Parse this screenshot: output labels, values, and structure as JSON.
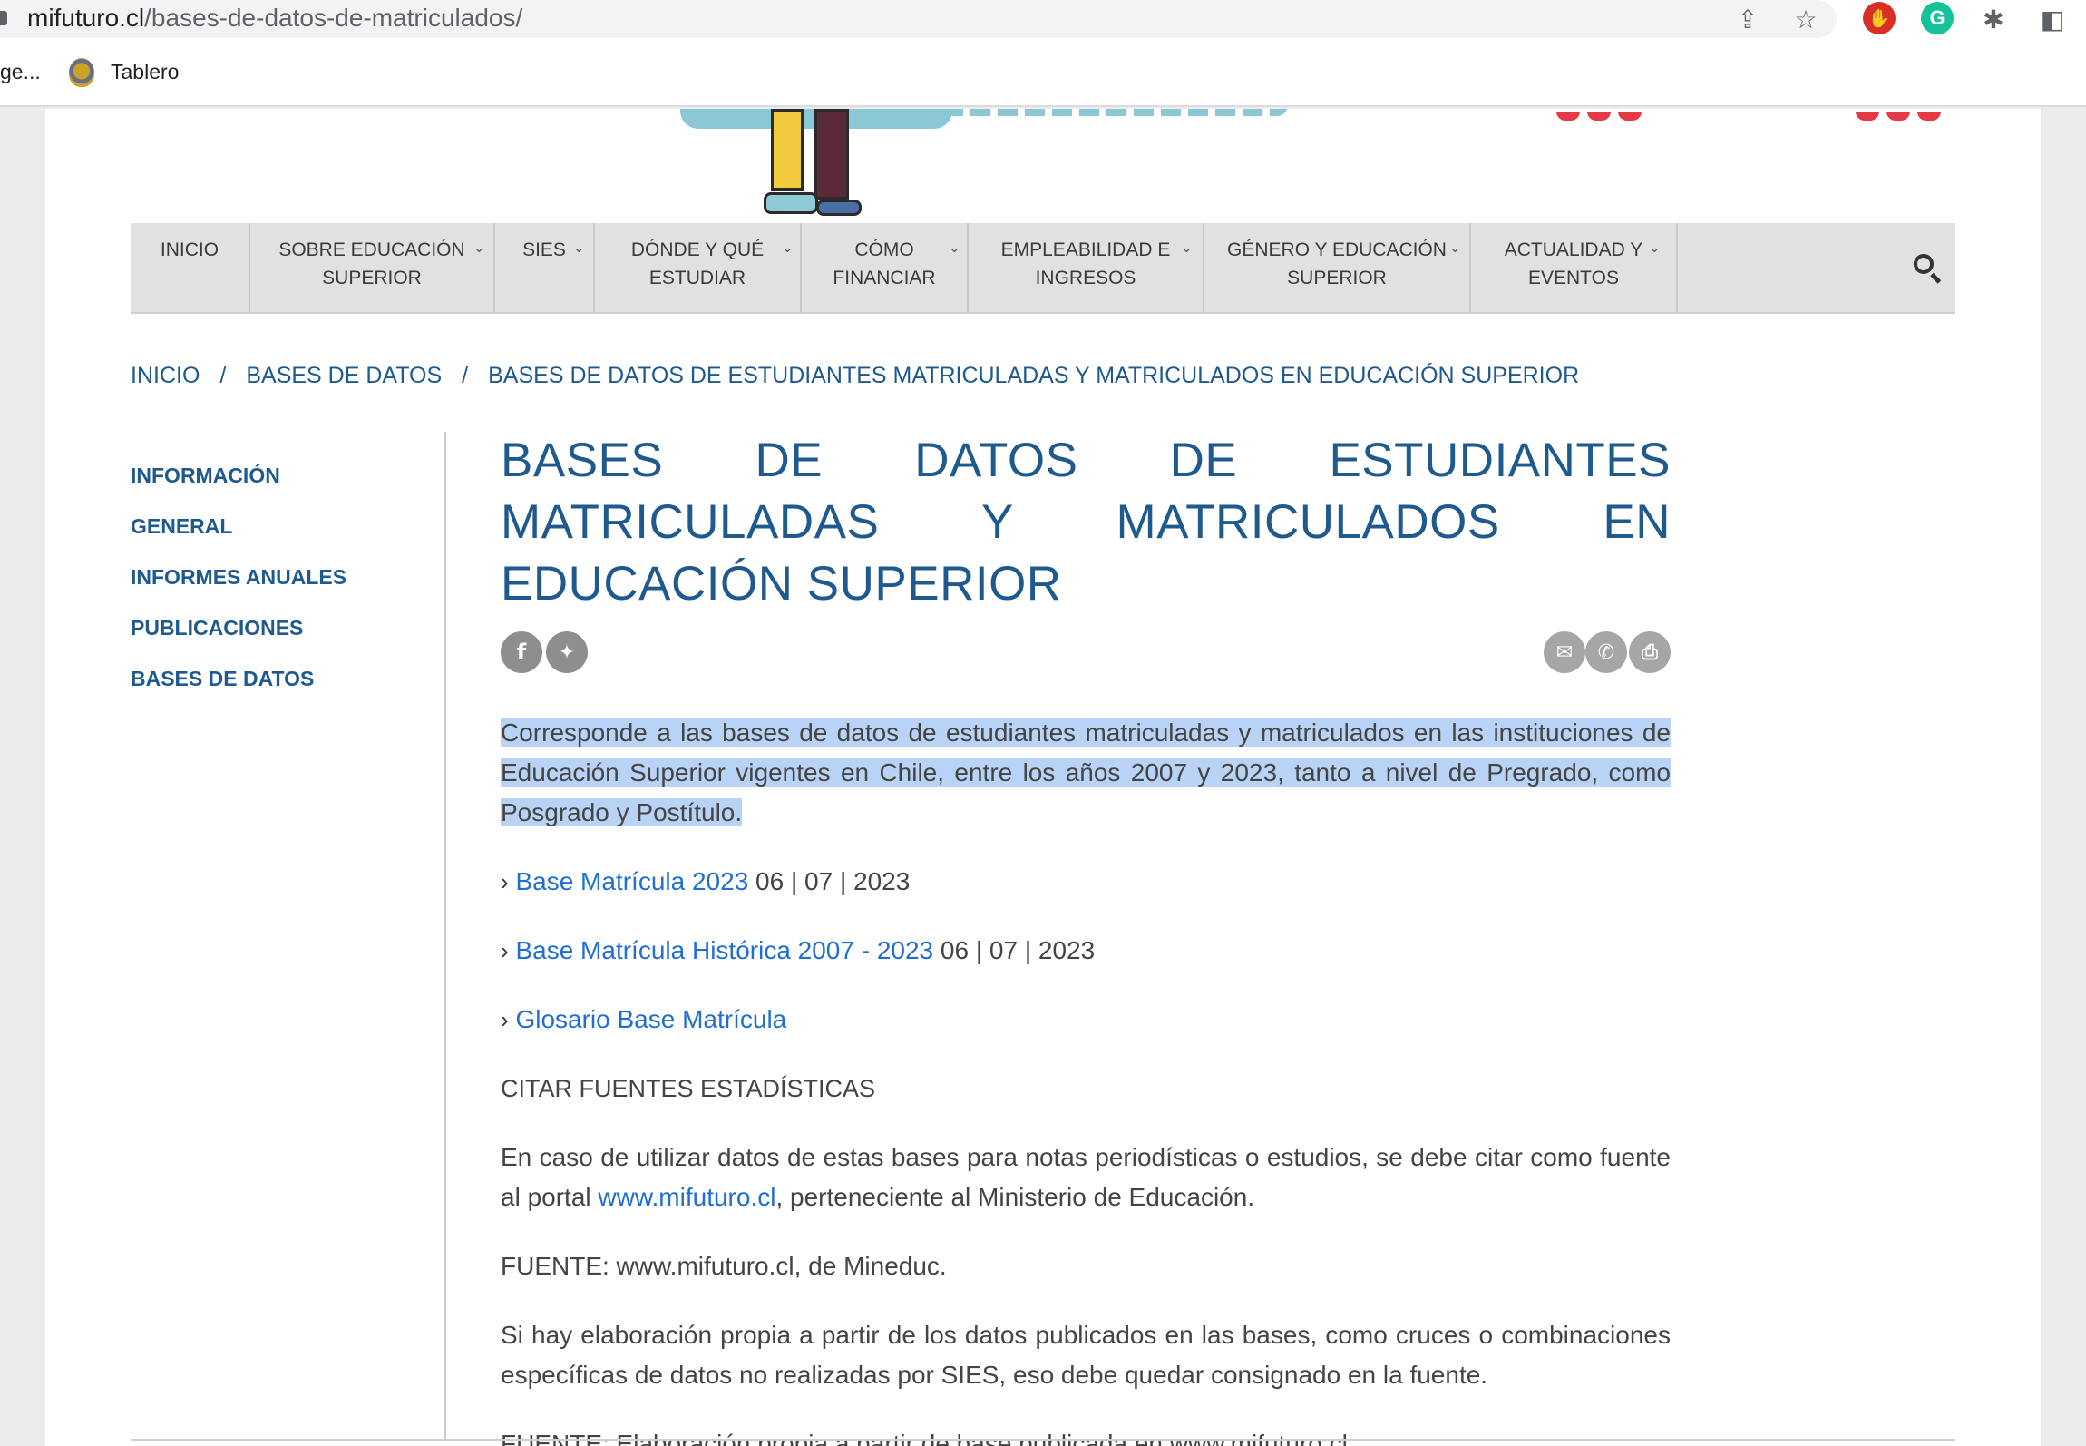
{
  "browser": {
    "url_domain": "mifuturo.cl",
    "url_path": "/bases-de-datos-de-matriculados/",
    "bookmark_truncated": "ge...",
    "bookmark_label": "Tablero",
    "icons": [
      "share-icon",
      "star-icon",
      "adblock-icon",
      "grammarly-icon",
      "puzzle-icon",
      "sidepanel-icon"
    ]
  },
  "nav": {
    "items": [
      {
        "line1": "INICIO",
        "line2": ""
      },
      {
        "line1": "SOBRE EDUCACIÓN",
        "line2": "SUPERIOR"
      },
      {
        "line1": "SIES",
        "line2": ""
      },
      {
        "line1": "DÓNDE Y QUÉ",
        "line2": "ESTUDIAR"
      },
      {
        "line1": "CÓMO",
        "line2": "FINANCIAR"
      },
      {
        "line1": "EMPLEABILIDAD E",
        "line2": "INGRESOS"
      },
      {
        "line1": "GÉNERO Y EDUCACIÓN",
        "line2": "SUPERIOR"
      },
      {
        "line1": "ACTUALIDAD Y",
        "line2": "EVENTOS"
      }
    ]
  },
  "breadcrumb": {
    "home": "INICIO",
    "section": "BASES DE DATOS",
    "current": "BASES DE DATOS DE ESTUDIANTES MATRICULADAS Y MATRICULADOS EN EDUCACIÓN SUPERIOR",
    "separator": "/"
  },
  "sidebar": {
    "items": [
      "INFORMACIÓN",
      "GENERAL",
      "INFORMES ANUALES",
      "PUBLICACIONES",
      "BASES DE DATOS"
    ]
  },
  "main": {
    "title": "BASES DE DATOS DE ESTUDIANTES MATRICULADAS Y MATRICULADOS EN EDUCACIÓN SUPERIOR",
    "intro": "Corresponde a las bases de datos de estudiantes matriculadas y matriculados en las instituciones de Educación Superior vigentes en Chile, entre los años 2007 y 2023, tanto a nivel de Pregrado, como Posgrado y Postítulo.",
    "links": [
      {
        "arrow": "›",
        "label": "Base Matrícula 2023",
        "date": " 06 | 07 | 2023"
      },
      {
        "arrow": "›",
        "label": "Base Matrícula Histórica 2007 - 2023",
        "date": "06 | 07 | 2023"
      },
      {
        "arrow": "›",
        "label": "Glosario Base Matrícula",
        "date": ""
      }
    ],
    "cite_title": "CITAR FUENTES ESTADÍSTICAS",
    "cite_p1_before": "En caso de utilizar datos de estas bases para notas periodísticas o estudios, se debe citar como fuente al portal ",
    "cite_p1_link": "www.mifuturo.cl",
    "cite_p1_after": ", perteneciente al Ministerio de Educación.",
    "source1": "FUENTE: www.mifuturo.cl, de Mineduc.",
    "cite_p2": "Si hay elaboración propia a partir de los datos publicados en las bases, como cruces o combinaciones específicas de datos no realizadas por SIES, eso debe quedar consignado en la fuente.",
    "source2": "FUENTE: Elaboración propia a partir de base publicada en www.mifuturo.cl"
  },
  "colors": {
    "accent_blue": "#1f5a8f",
    "link_blue": "#1f6fd1",
    "highlight": "#b8d3f5",
    "nav_bg": "#e1e1e1"
  }
}
